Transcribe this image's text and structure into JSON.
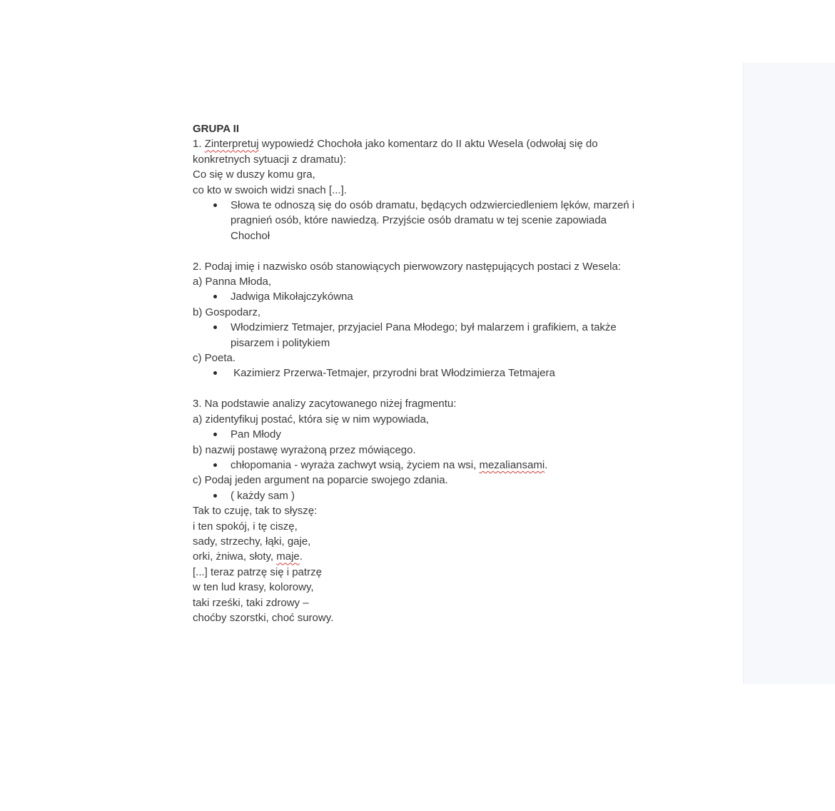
{
  "doc": {
    "title": "GRUPA II",
    "q1": {
      "num": "1.",
      "misspelled": "Zinterpretuj",
      "rest": "wypowiedź Chochoła jako komentarz do II aktu Wesela (odwołaj się do",
      "line2": "konkretnych sytuacji z dramatu):",
      "quote1": "Co się w duszy komu gra,",
      "quote2": "co kto w swoich widzi snach [...].",
      "answer_l1": "Słowa te odnoszą się do osób dramatu, będących odzwierciedleniem lęków, marzeń i",
      "answer_l2": "pragnień osób, które nawiedzą. Przyjście osób dramatu w tej scenie zapowiada",
      "answer_l3": "Chochoł"
    },
    "q2": {
      "question": "2. Podaj imię i nazwisko osób stanowiących pierwowzory następujących postaci z Wesela:",
      "a_label": "a) Panna Młoda,",
      "a_answer": "Jadwiga Mikołajczykówna",
      "b_label": "b) Gospodarz,",
      "b_answer_l1": "Włodzimierz Tetmajer, przyjaciel Pana Młodego; był malarzem i grafikiem, a także",
      "b_answer_l2": "pisarzem i politykiem",
      "c_label": "c) Poeta.",
      "c_answer": " Kazimierz Przerwa-Tetmajer, przyrodni brat Włodzimierza Tetmajera"
    },
    "q3": {
      "question": "3. Na podstawie analizy zacytowanego niżej fragmentu:",
      "a_label": "a) zidentyfikuj postać, która się w nim wypowiada,",
      "a_answer": "Pan Młody",
      "b_label": "b) nazwij postawę wyrażoną przez mówiącego.",
      "b_answer_pre": "chłopomania - wyraża zachwyt wsią, życiem na wsi,",
      "b_answer_misspelled": "mezaliansami",
      "b_answer_post": ".",
      "c_label": "c) Podaj jeden argument na poparcie swojego zdania.",
      "c_answer": "( każdy sam )",
      "poem": {
        "l1": "Tak to czuję, tak to słyszę:",
        "l2": "i ten spokój, i tę ciszę,",
        "l3": "sady, strzechy, łąki, gaje,",
        "l4_pre": "orki, żniwa, słoty,",
        "l4_misspelled": "maje",
        "l4_post": ".",
        "l5": "[...] teraz patrzę się i patrzę",
        "l6": "w ten lud krasy, kolorowy,",
        "l7": "taki rześki, taki zdrowy –",
        "l8": "choćby szorstki, choć surowy."
      }
    }
  }
}
